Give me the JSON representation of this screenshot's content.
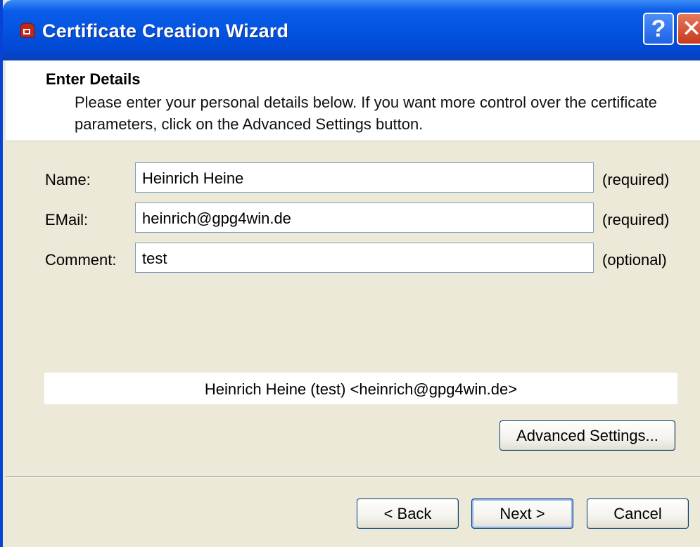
{
  "window": {
    "title": "Certificate Creation Wizard",
    "help_label": "?",
    "close_label": "✕"
  },
  "header": {
    "heading": "Enter Details",
    "description": "Please enter your personal details below. If you want more control over the certificate parameters, click on the Advanced Settings button."
  },
  "form": {
    "name": {
      "label": "Name:",
      "value": "Heinrich Heine",
      "hint": "(required)"
    },
    "email": {
      "label": "EMail:",
      "value": "heinrich@gpg4win.de",
      "hint": "(required)"
    },
    "comment": {
      "label": "Comment:",
      "value": "test",
      "hint": "(optional)"
    }
  },
  "preview": "Heinrich Heine (test) <heinrich@gpg4win.de>",
  "buttons": {
    "advanced": "Advanced Settings...",
    "back": "< Back",
    "next": "Next >",
    "cancel": "Cancel"
  }
}
